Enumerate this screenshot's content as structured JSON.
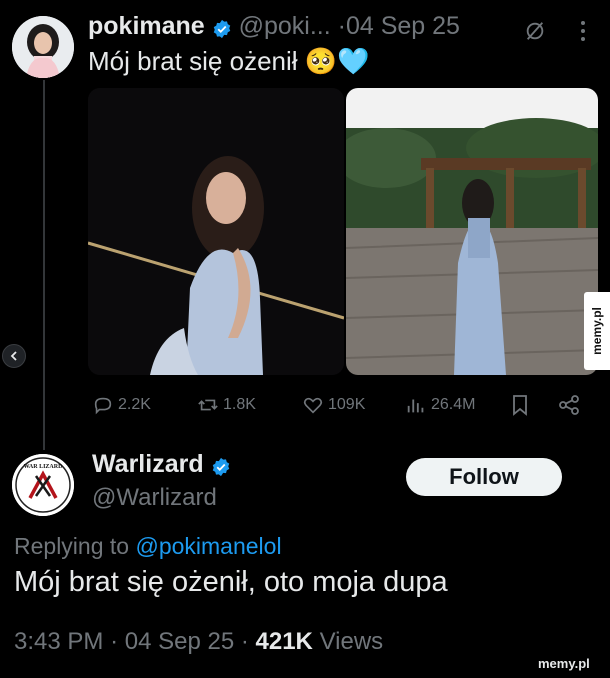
{
  "tweet": {
    "author_name": "pokimane",
    "handle": "@poki...",
    "sep": "·",
    "date": "04 Sep 25",
    "text": "Mój brat się ożenił 🥺🩵"
  },
  "stats": {
    "replies": "2.2K",
    "reposts": "1.8K",
    "likes": "109K",
    "views": "26.4M"
  },
  "reply": {
    "author_name": "Warlizard",
    "handle": "@Warlizard",
    "follow_label": "Follow",
    "replying_prefix": "Replying to",
    "replying_handle": "@pokimanelol",
    "text": "Mój brat się ożenił, oto moja dupa",
    "time": "3:43 PM",
    "date": "04 Sep 25",
    "views_count": "421K",
    "views_label": "Views"
  },
  "watermark": {
    "side": "memy.pl",
    "bottom": "memy.pl"
  },
  "logo_text": "WAR LIZARD",
  "colors": {
    "background": "#000000",
    "text": "#e7e9ea",
    "muted": "#71767b",
    "verified": "#1d9bf0",
    "reply_link": "#1d9bf0"
  },
  "icons": [
    "verified-badge",
    "grok-icon",
    "more-icon",
    "reply-icon",
    "repost-icon",
    "like-icon",
    "views-icon",
    "bookmark-icon",
    "share-icon",
    "scroll-left-icon"
  ]
}
